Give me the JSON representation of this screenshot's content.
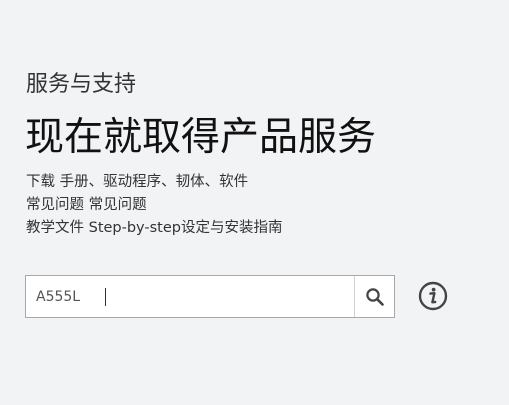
{
  "section": {
    "label": "服务与支持"
  },
  "hero": {
    "title": "现在就取得产品服务"
  },
  "lines": [
    "下载 手册、驱动程序、韧体、软件",
    "常见问题 常见问题",
    "教学文件 Step-by-step设定与安装指南"
  ],
  "search": {
    "value": "A555L",
    "placeholder": ""
  },
  "icons": {
    "search": "search-icon",
    "info": "info-icon"
  },
  "colors": {
    "background": "#f2f3f5",
    "title": "#111111",
    "text": "#333333",
    "border": "#a8a8a8",
    "icon": "#444444"
  }
}
